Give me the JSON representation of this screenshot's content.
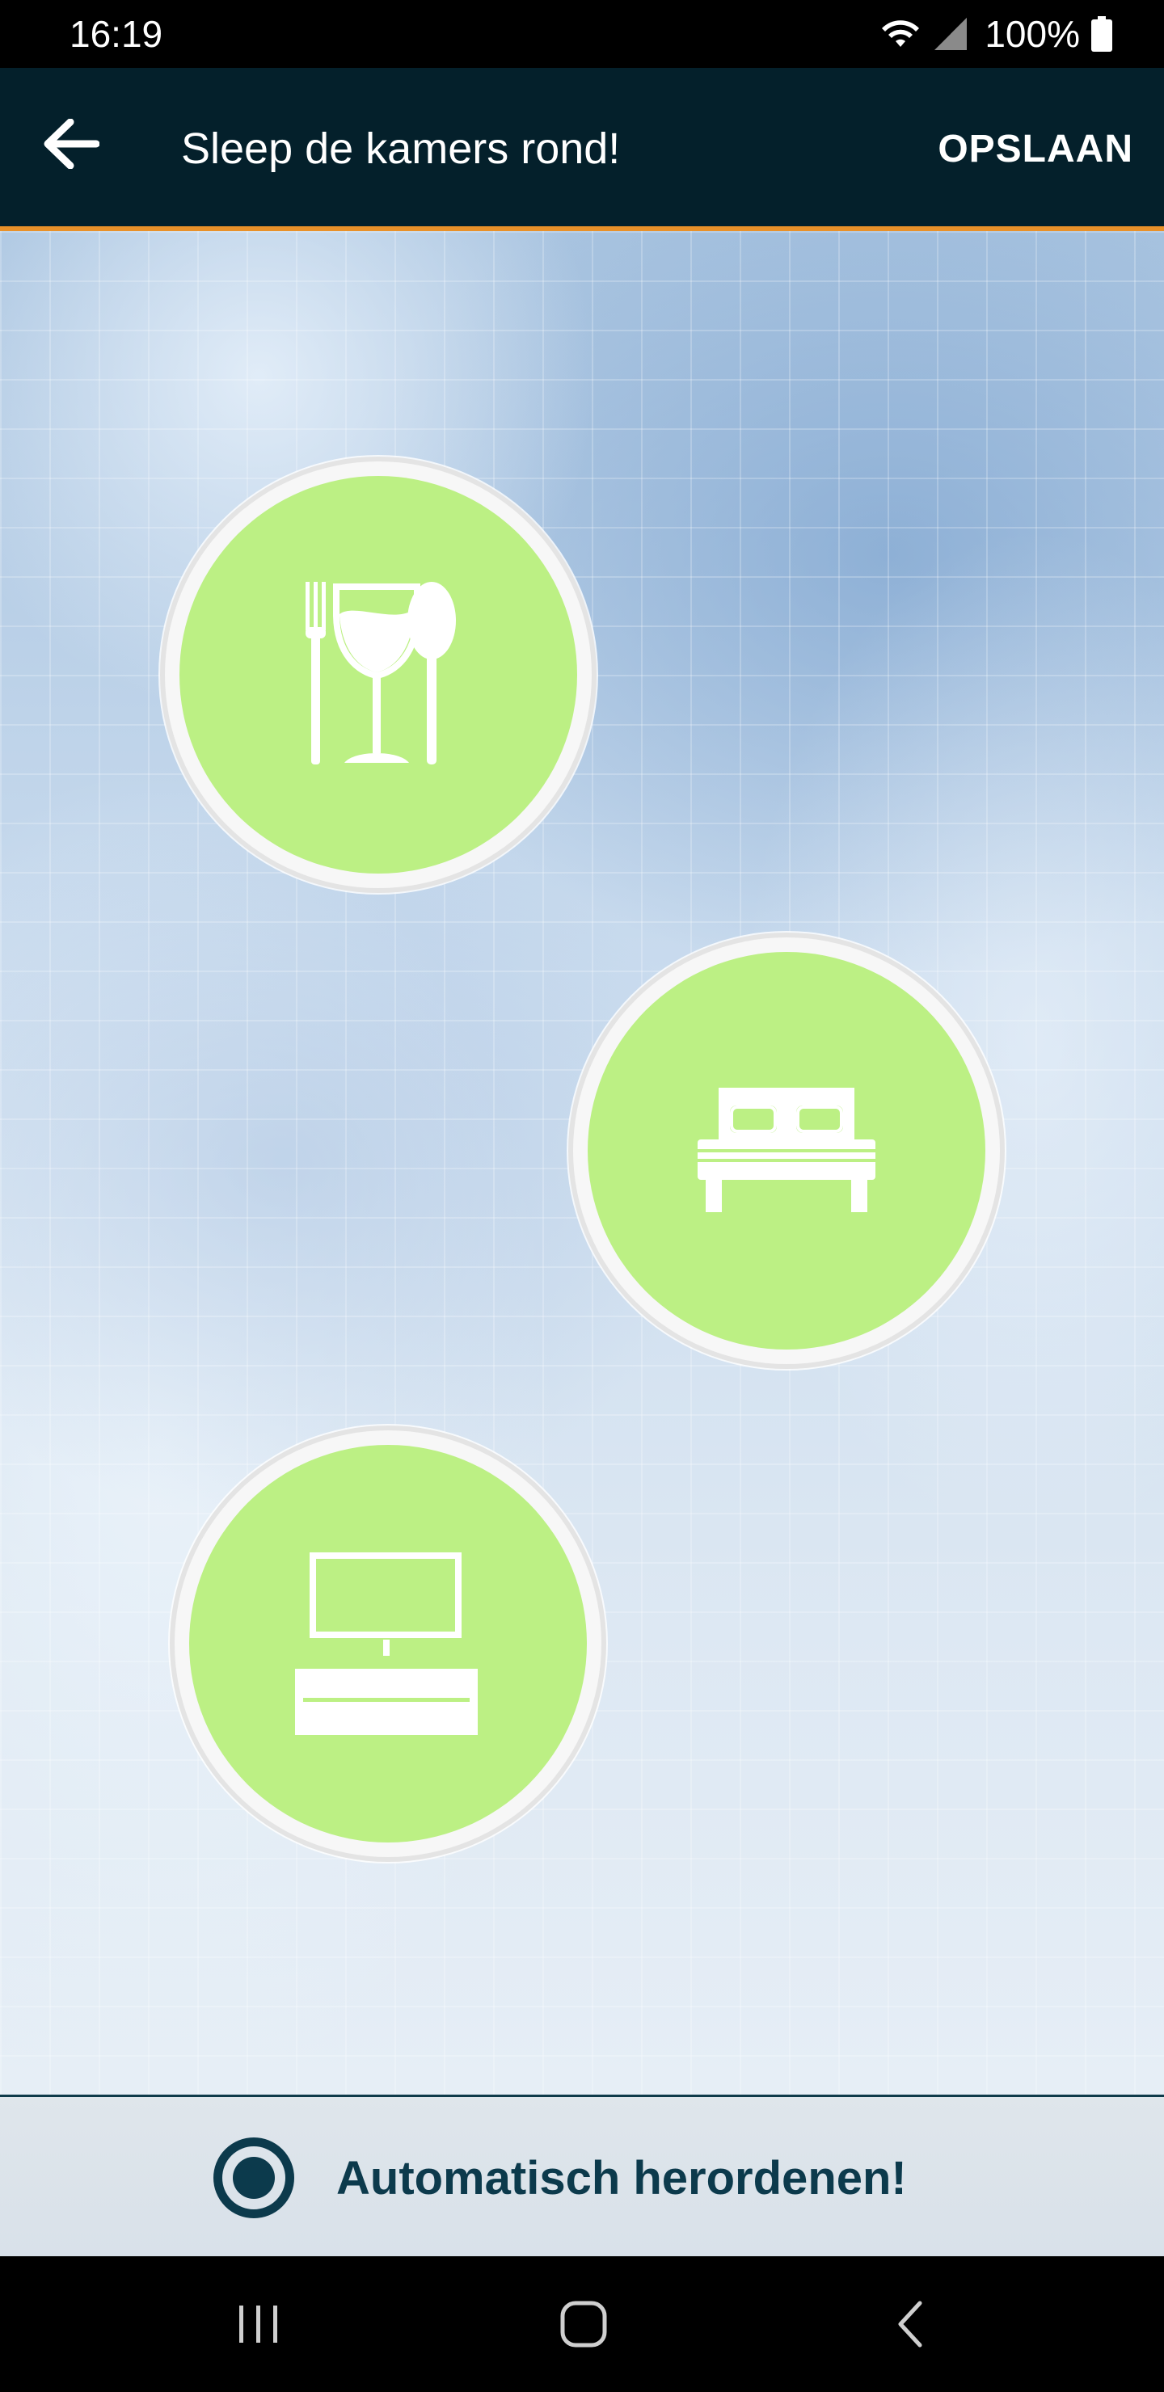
{
  "status_bar": {
    "time": "16:19",
    "battery": "100%",
    "icons": [
      "wifi-icon",
      "cell-signal-icon",
      "battery-icon"
    ]
  },
  "app_bar": {
    "back_icon": "arrow-left-icon",
    "title": "Sleep de kamers rond!",
    "save_label": "OPSLAAN"
  },
  "rooms": [
    {
      "name": "dining-room",
      "icon": "dining-icon"
    },
    {
      "name": "bedroom",
      "icon": "bed-icon"
    },
    {
      "name": "living-room",
      "icon": "tv-furniture-icon"
    }
  ],
  "bottom": {
    "auto_reorder_label": "Automatisch herordenen!",
    "auto_reorder_selected": true
  },
  "nav_bar": {
    "buttons": [
      "recents-icon",
      "home-icon",
      "back-icon"
    ]
  },
  "colors": {
    "app_bar": "#04202b",
    "accent_underline": "#e8912a",
    "room_fill": "#bcf084",
    "radio": "#0c3a4c"
  }
}
